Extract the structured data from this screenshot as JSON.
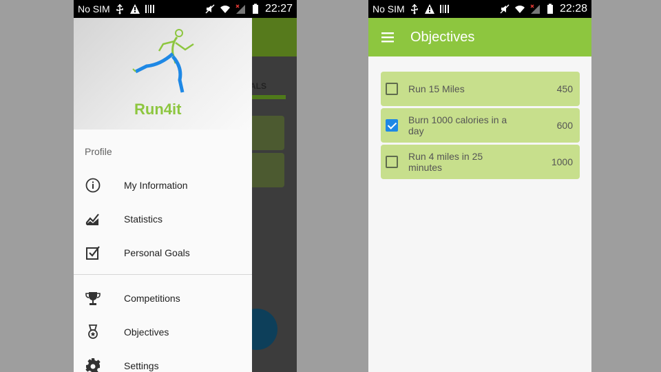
{
  "left_screen": {
    "status": {
      "carrier": "No SIM",
      "time": "22:27"
    },
    "background_app": {
      "tab_label": "ALS"
    },
    "drawer": {
      "app_name": "Run4it",
      "section_label": "Profile",
      "items": [
        {
          "label": "My Information",
          "icon": "info-icon"
        },
        {
          "label": "Statistics",
          "icon": "chart-icon"
        },
        {
          "label": "Personal Goals",
          "icon": "checkbox-icon"
        },
        {
          "label": "Competitions",
          "icon": "trophy-icon"
        },
        {
          "label": "Objectives",
          "icon": "medal-icon"
        },
        {
          "label": "Settings",
          "icon": "gear-icon"
        }
      ]
    }
  },
  "right_screen": {
    "status": {
      "carrier": "No SIM",
      "time": "22:28"
    },
    "toolbar": {
      "title": "Objectives"
    },
    "objectives": [
      {
        "label": "Run 15 Miles",
        "points": "450",
        "checked": false
      },
      {
        "label": "Burn 1000 calories in a day",
        "points": "600",
        "checked": true
      },
      {
        "label": "Run 4 miles in 25 minutes",
        "points": "1000",
        "checked": false
      }
    ]
  },
  "colors": {
    "accent_green": "#8dc63f",
    "row_green": "#c7df8c",
    "check_blue": "#1e88e5"
  }
}
